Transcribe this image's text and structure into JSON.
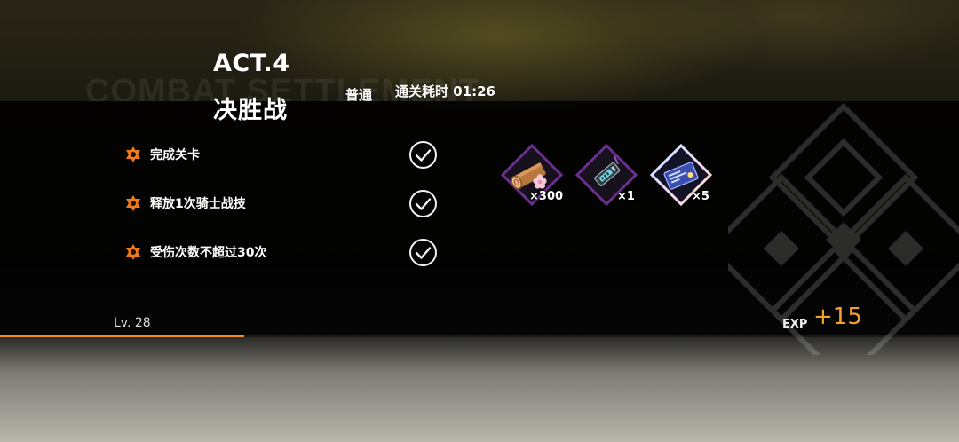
{
  "background_title": "COMBAT SETTLEMENT",
  "stage": {
    "act": "ACT.4",
    "name": "决胜战",
    "difficulty": "普通",
    "clear_time": "通关耗时 01:26"
  },
  "objectives": [
    {
      "label": "完成关卡",
      "completed": true
    },
    {
      "label": "释放1次骑士战技",
      "completed": true
    },
    {
      "label": "受伤次数不超过30次",
      "completed": true
    }
  ],
  "rewards": [
    {
      "icon": "sakura-wood-log-icon",
      "quantity": "×300",
      "frame_color": "#6b2f8f"
    },
    {
      "icon": "memory-chip-icon",
      "quantity": "×1",
      "frame_color": "#6b2f8f"
    },
    {
      "icon": "blueprint-card-icon",
      "quantity": "×5",
      "frame_color": "#d9b8ff"
    }
  ],
  "player": {
    "level": "Lv. 28",
    "exp_label": "EXP",
    "exp_gain": "+15",
    "exp_progress": 0.255
  },
  "colors": {
    "accent": "#f08c1e",
    "exp_text": "#f5a02a",
    "star": "#f07a1a"
  }
}
